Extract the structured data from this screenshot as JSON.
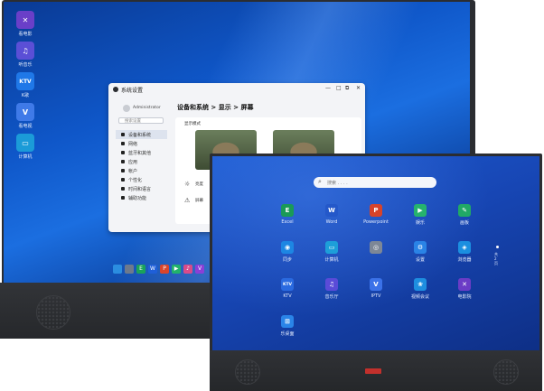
{
  "desktop_icons": [
    {
      "label": "看电影",
      "glyph": "✕",
      "color": "#6a3fc8"
    },
    {
      "label": "听音乐",
      "glyph": "♫",
      "color": "#5b4fd6"
    },
    {
      "label": "K歌",
      "glyph": "KTV",
      "color": "#1f78e8"
    },
    {
      "label": "看电视",
      "glyph": "V",
      "color": "#3f7ae8"
    },
    {
      "label": "计算机",
      "glyph": "▭",
      "color": "#1b9bd8"
    }
  ],
  "settings_window": {
    "title": "系统设置",
    "controls": {
      "minimize": "—",
      "maximize": "□",
      "restore": "⧉",
      "close": "✕"
    },
    "user_name": "Administrator",
    "search_placeholder": "搜索设置",
    "breadcrumb": "设备和系统 > 显示 > 屏幕",
    "sidebar": [
      {
        "label": "设备和系统",
        "active": true
      },
      {
        "label": "网络"
      },
      {
        "label": "蓝牙和其他"
      },
      {
        "label": "应用"
      },
      {
        "label": "帐户"
      },
      {
        "label": "个性化"
      },
      {
        "label": "时间和语言"
      },
      {
        "label": "辅助功能"
      }
    ],
    "section_label": "显示模式",
    "options": [
      {
        "label": "亮度"
      },
      {
        "label": "屏幕"
      }
    ]
  },
  "back_taskbar": [
    {
      "color": "#1aa35a",
      "glyph": "E"
    },
    {
      "color": "#1f5fd8",
      "glyph": "W"
    },
    {
      "color": "#d9452b",
      "glyph": "P"
    },
    {
      "color": "#22b26b",
      "glyph": "▶"
    },
    {
      "color": "#d84b8a",
      "glyph": "♪"
    },
    {
      "color": "#8b3fd6",
      "glyph": "V"
    }
  ],
  "front_screen": {
    "search_placeholder": "搜索 . . . .",
    "apps": [
      {
        "label": "Excel",
        "glyph": "E",
        "color": "#1a9a57"
      },
      {
        "label": "Word",
        "glyph": "W",
        "color": "#2458c9"
      },
      {
        "label": "Powerpoint",
        "glyph": "P",
        "color": "#d7432a"
      },
      {
        "label": "娱乐",
        "glyph": "▶",
        "color": "#26b36d"
      },
      {
        "label": "画板",
        "glyph": "✎",
        "color": "#21a866"
      },
      {
        "label": "同步",
        "glyph": "◉",
        "color": "#1d86e3"
      },
      {
        "label": "计算机",
        "glyph": "▭",
        "color": "#1d9fd9"
      },
      {
        "label": "",
        "glyph": "◎",
        "color": "#7d8796"
      },
      {
        "label": "设置",
        "glyph": "⚙",
        "color": "#2a83e6"
      },
      {
        "label": "浏览器",
        "glyph": "◈",
        "color": "#1b8fe0"
      },
      {
        "label": "KTV",
        "glyph": "KTV",
        "color": "#2a6ae0"
      },
      {
        "label": "音乐厅",
        "glyph": "♫",
        "color": "#5a4bd8"
      },
      {
        "label": "IPTV",
        "glyph": "V",
        "color": "#3b72e8"
      },
      {
        "label": "视频会议",
        "glyph": "❀",
        "color": "#1e8ee0"
      },
      {
        "label": "电影院",
        "glyph": "✕",
        "color": "#6b3cc6"
      },
      {
        "label": "乐桌面",
        "glyph": "⊞",
        "color": "#2a84e8"
      }
    ],
    "pager": "共 2 页"
  }
}
